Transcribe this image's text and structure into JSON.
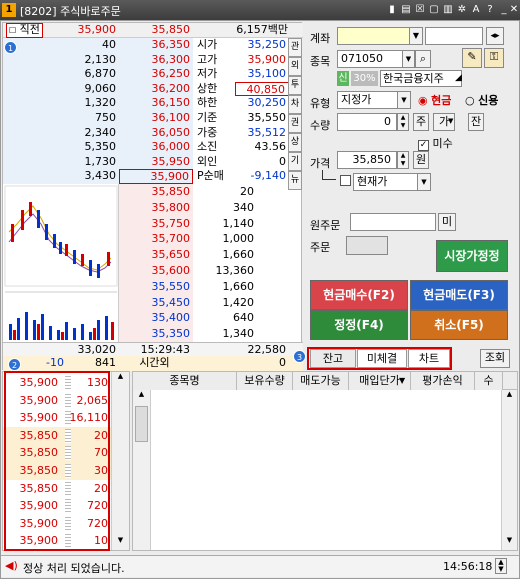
{
  "title": {
    "num": "1",
    "text": "[8202] 주식바로주문"
  },
  "orderbook": {
    "header": {
      "mode": "직전",
      "price": "35,900",
      "cur": "35,850",
      "amount": "6,157백만"
    },
    "sell_rows": [
      {
        "qty": "40",
        "price": "36,350",
        "lbl": "시가",
        "val": "35,250",
        "val_color": "blue"
      },
      {
        "qty": "2,130",
        "price": "36,300",
        "lbl": "고가",
        "val": "35,900",
        "val_color": "red"
      },
      {
        "qty": "6,870",
        "price": "36,250",
        "lbl": "저가",
        "val": "35,100",
        "val_color": "blue"
      },
      {
        "qty": "9,060",
        "price": "36,200",
        "lbl": "상한",
        "val": "40,850",
        "val_color": "red"
      },
      {
        "qty": "1,320",
        "price": "36,150",
        "lbl": "하한",
        "val": "30,250",
        "val_color": "blue"
      },
      {
        "qty": "750",
        "price": "36,100",
        "lbl": "기준",
        "val": "35,550",
        "val_color": ""
      },
      {
        "qty": "2,340",
        "price": "36,050",
        "lbl": "가중",
        "val": "35,512",
        "val_color": "blue"
      },
      {
        "qty": "5,350",
        "price": "36,000",
        "lbl": "소진",
        "val": "43.56",
        "val_color": ""
      },
      {
        "qty": "1,730",
        "price": "35,950",
        "lbl": "외인",
        "val": "0",
        "val_color": ""
      },
      {
        "qty": "3,430",
        "price": "35,900",
        "lbl": "P순매",
        "val": "-9,140",
        "val_color": "blue"
      }
    ],
    "buy_rows": [
      {
        "price": "35,850",
        "qty": "20"
      },
      {
        "price": "35,800",
        "qty": "340"
      },
      {
        "price": "35,750",
        "qty": "1,140"
      },
      {
        "price": "35,700",
        "qty": "1,000"
      },
      {
        "price": "35,650",
        "qty": "1,660"
      },
      {
        "price": "35,600",
        "qty": "13,360"
      },
      {
        "price": "35,550",
        "qty": "1,660"
      },
      {
        "price": "35,450",
        "qty": "1,420"
      },
      {
        "price": "35,400",
        "qty": "640"
      },
      {
        "price": "35,350",
        "qty": "1,340"
      }
    ],
    "totals": {
      "sell": "33,020",
      "time": "15:29:43",
      "buy": "22,580"
    },
    "after": {
      "diff": "-10",
      "vol": "841",
      "label": "시간외",
      "val": "0"
    },
    "side_tabs": [
      "관",
      "외",
      "투",
      "차",
      "권",
      "상",
      "기",
      "뉴"
    ]
  },
  "order_form": {
    "account_label": "계좌",
    "code_label": "종목",
    "code_value": "071050",
    "credit_badge": "신",
    "margin_badge": "30%",
    "stock_name": "한국금융지주",
    "type_label": "유형",
    "type_value": "지정가",
    "cash_label": "현금",
    "credit_label": "신용",
    "qty_label": "수량",
    "qty_value": "0",
    "qty_btn1": "주",
    "qty_btn2": "가",
    "qty_btn3": "잔",
    "undecided_label": "미수",
    "price_label": "가격",
    "price_value": "35,850",
    "price_unit": "원",
    "current_price_label": "현재가",
    "orig_order_label": "원주문",
    "orig_btn": "미",
    "order_label": "주문",
    "buttons": {
      "market_fix": "시장가정정",
      "buy": "현금매수(F2)",
      "sell": "현금매도(F3)",
      "modify": "정정(F4)",
      "cancel": "취소(F5)"
    }
  },
  "tabs": {
    "items": [
      "잔고",
      "미체결",
      "차트"
    ],
    "query": "조회"
  },
  "ticks": [
    {
      "price": "35,900",
      "qty": "130",
      "hl": false
    },
    {
      "price": "35,900",
      "qty": "2,065",
      "hl": false
    },
    {
      "price": "35,900",
      "qty": "16,110",
      "hl": false
    },
    {
      "price": "35,850",
      "qty": "20",
      "hl": true
    },
    {
      "price": "35,850",
      "qty": "70",
      "hl": true
    },
    {
      "price": "35,850",
      "qty": "30",
      "hl": true
    },
    {
      "price": "35,850",
      "qty": "20",
      "hl": false
    },
    {
      "price": "35,900",
      "qty": "720",
      "hl": false
    },
    {
      "price": "35,900",
      "qty": "720",
      "hl": false
    },
    {
      "price": "35,900",
      "qty": "10",
      "hl": false
    }
  ],
  "grid_headers": [
    "종목명",
    "보유수량",
    "매도가능",
    "매입단가",
    "평가손익",
    "수"
  ],
  "status": {
    "message": "정상 처리 되었습니다.",
    "time": "14:56:18"
  },
  "badges": [
    "1",
    "2",
    "3"
  ],
  "colors": {
    "red": "#d40000",
    "blue": "#0033cc",
    "buy_btn": "#d9444a",
    "sell_btn": "#2a63c2",
    "modify_btn": "#2e8b3a",
    "cancel_btn": "#d0701c",
    "market_btn": "#2e9b4a"
  }
}
